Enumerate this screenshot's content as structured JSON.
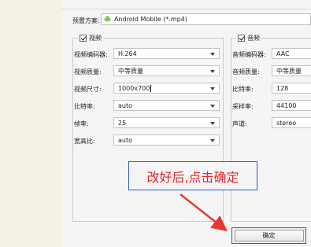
{
  "preset": {
    "label": "预置方案:",
    "value": "Android Mobile (*.mp4)",
    "icon": "android-icon"
  },
  "video": {
    "title": "视频",
    "checked": true,
    "rows": [
      {
        "label": "视频编码器:",
        "value": "H.264"
      },
      {
        "label": "视频质量:",
        "value": "中等质量"
      },
      {
        "label": "视频尺寸:",
        "value": "1000x700"
      },
      {
        "label": "比特率:",
        "value": "auto"
      },
      {
        "label": "帧率:",
        "value": "25"
      },
      {
        "label": "宽高比:",
        "value": "auto"
      }
    ]
  },
  "audio": {
    "title": "音频",
    "checked": true,
    "rows": [
      {
        "label": "音频编码器:",
        "value": "AAC"
      },
      {
        "label": "音频质量:",
        "value": "中等质量"
      },
      {
        "label": "比特率:",
        "value": "128"
      },
      {
        "label": "采样率:",
        "value": "44100"
      },
      {
        "label": "声道:",
        "value": "stereo"
      }
    ]
  },
  "annotation": {
    "text": "改好后,点击确定",
    "text_color": "#e0252c",
    "border_color": "#2f5cc4"
  },
  "footer": {
    "ok_label": "确定"
  }
}
